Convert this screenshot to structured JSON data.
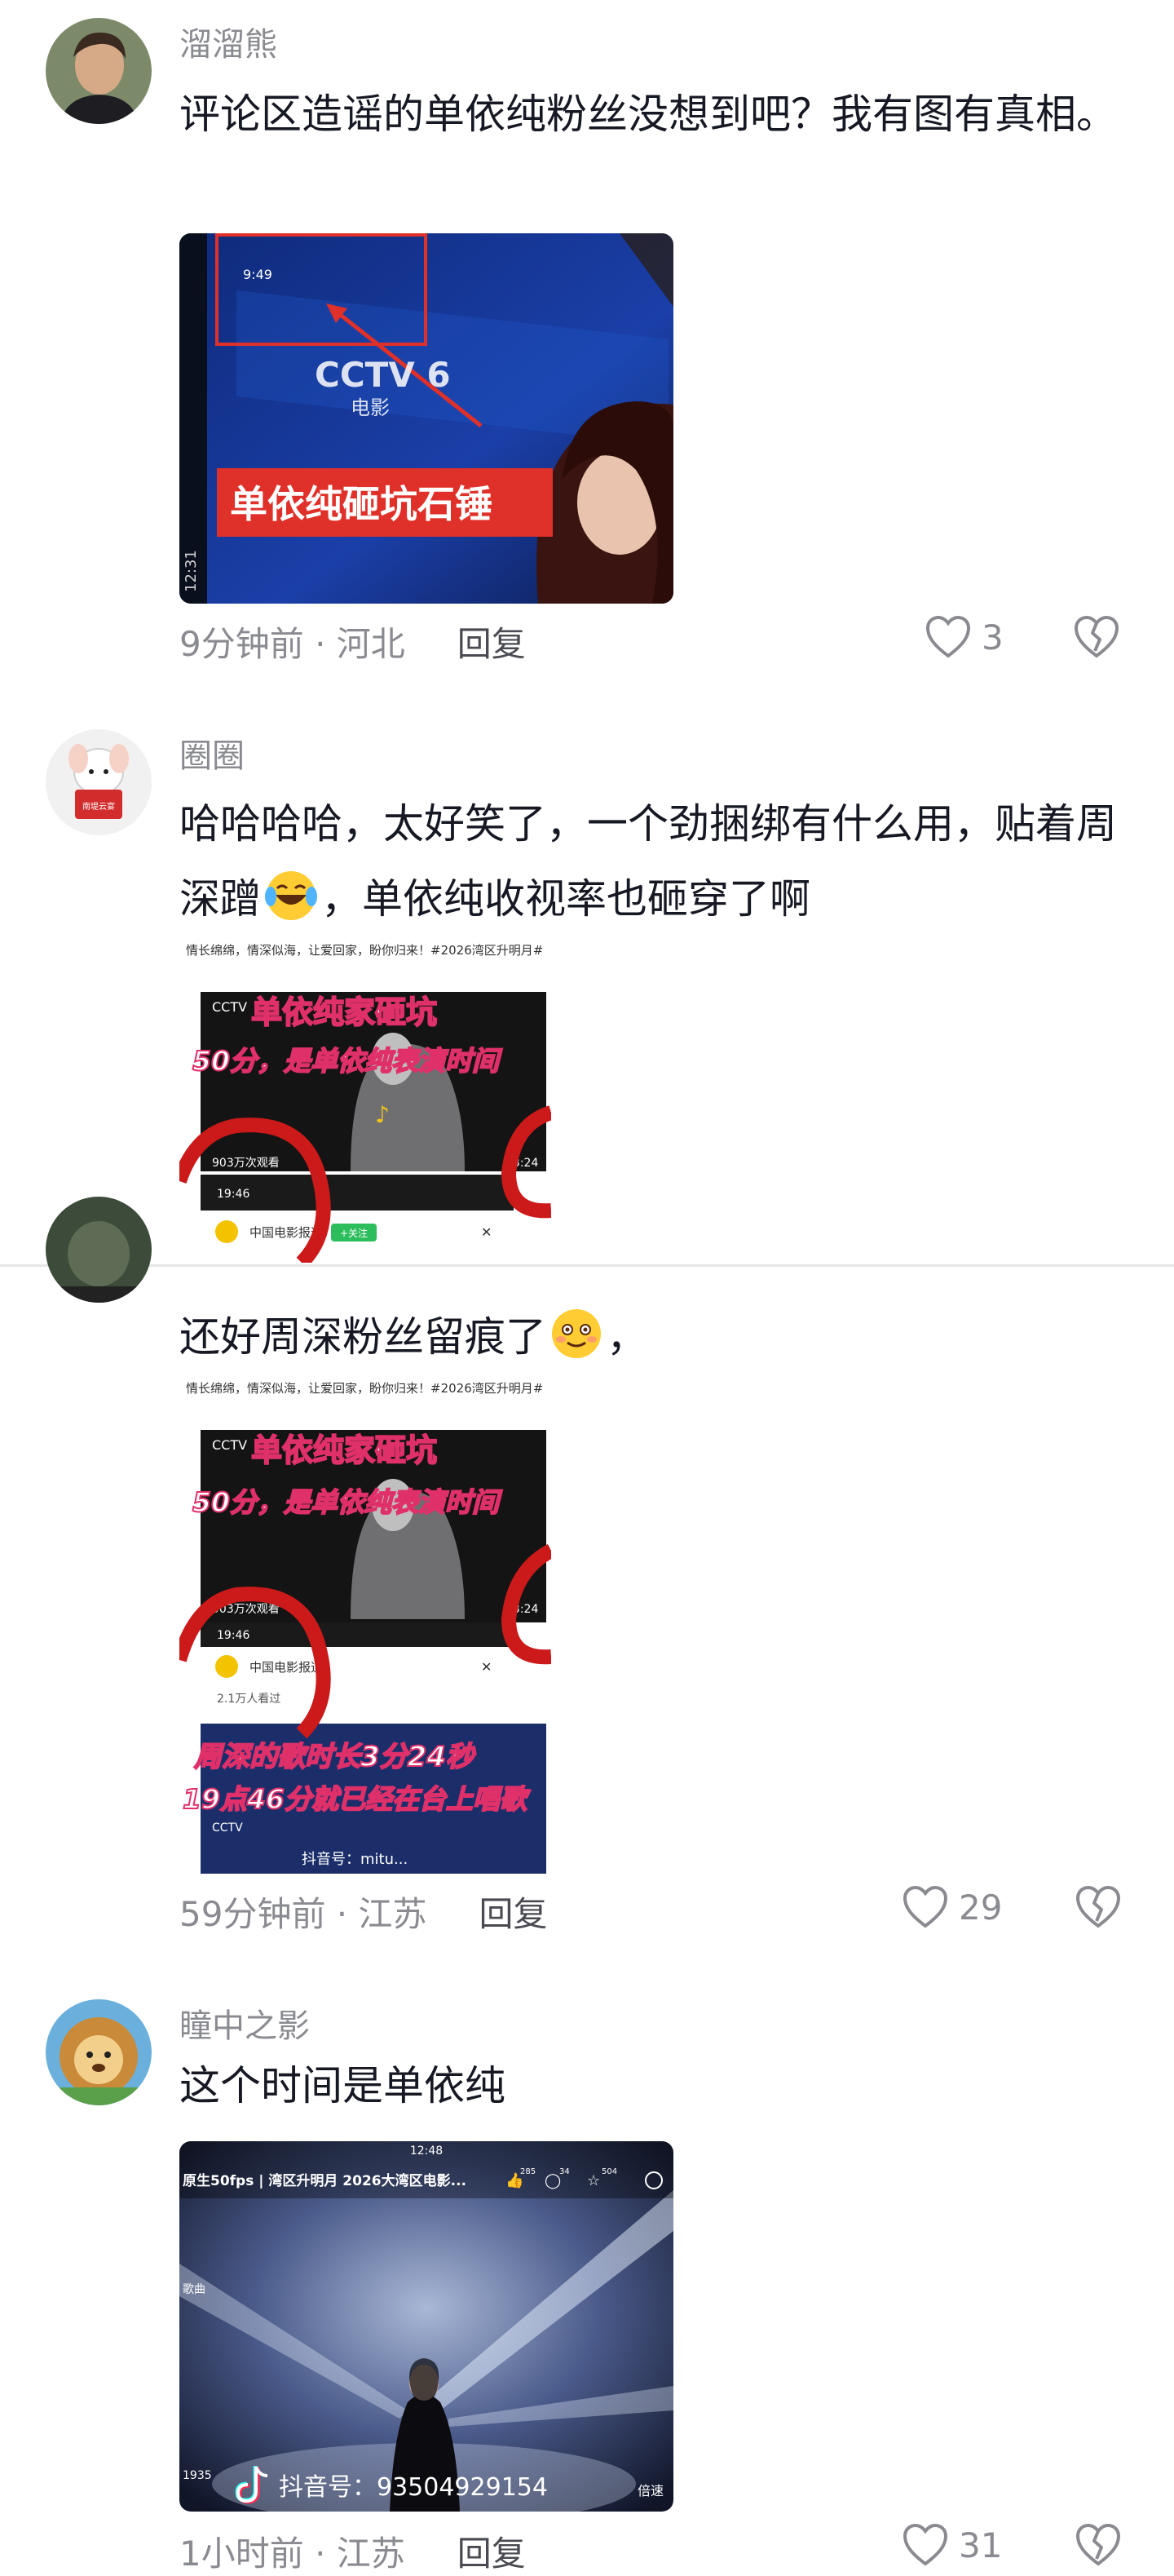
{
  "comments": [
    {
      "username": "溜溜熊",
      "text": "评论区造谣的单依纯粉丝没想到吧？我有图有真相。",
      "image": {
        "overlay_text": "单依纯砸坑石锤",
        "channel_logo": "CCTV 6",
        "channel_sub": "电影",
        "status_time": "9:49",
        "side_time": "12:31"
      },
      "time_location": "9分钟前 · 河北",
      "reply_label": "回复",
      "likes": "3"
    },
    {
      "username": "圈圈",
      "avatar_badge": "南堤云宴",
      "text_before_emoji": "哈哈哈哈，太好笑了，一个劲捆绑有什么用，贴着周深蹭",
      "text_after_emoji": "，单依纯收视率也砸穿了啊",
      "image": {
        "caption": "情长绵绵，情深似海，让爱回家，盼你归来！#2026湾区升明月#",
        "title1": "单依纯家砸坑",
        "title2": "50分，是单依纯表演时间",
        "views": "903万次观看",
        "duration": "03:24",
        "status_time": "19:46",
        "account": "中国电影报道",
        "follow_label": "+关注"
      }
    },
    {
      "username": "",
      "text": "还好周深粉丝留痕了",
      "text_tail": "，",
      "image": {
        "caption": "情长绵绵，情深似海，让爱回家，盼你归来！#2026湾区升明月#",
        "title1": "单依纯家砸坑",
        "title2": "50分，是单依纯表演时间",
        "views": "903万次观看",
        "duration": "03:24",
        "status_time": "19:46",
        "account": "中国电影报道",
        "seen": "2.1万人看过",
        "line3": "周深的歌时长3分24秒",
        "line4": "19点46分就已经在台上唱歌",
        "douyin": "抖音号：",
        "douyin_id": "mitu..."
      },
      "time_location": "59分钟前 · 江苏",
      "reply_label": "回复",
      "likes": "29"
    },
    {
      "username": "瞳中之影",
      "text": "这个时间是单依纯",
      "image": {
        "status_time": "12:48",
        "title": "原生50fps | 湾区升明月 2026大湾区电影...",
        "stat1": "285",
        "stat2": "34",
        "stat3": "504",
        "left_label": "歌曲",
        "bottom_left": "1935",
        "douyin": "抖音号：93504929154",
        "bottom_right": "倍速"
      },
      "time_location": "1小时前 · 江苏",
      "reply_label": "回复",
      "likes": "31"
    }
  ],
  "colors": {
    "text": "#161823",
    "secondary": "#8a8b91",
    "reply": "#4a4b52",
    "red": "#e0302a"
  },
  "icons": [
    "heart-outline-icon",
    "broken-heart-icon",
    "tiktok-logo-icon"
  ]
}
